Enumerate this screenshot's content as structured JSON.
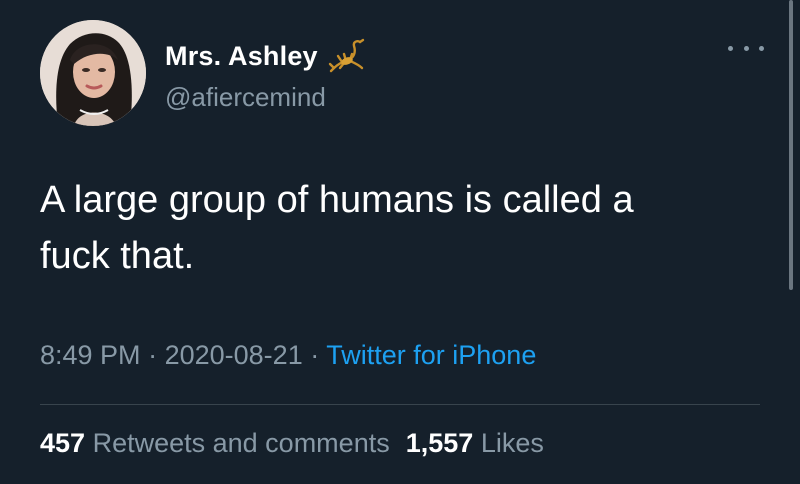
{
  "author": {
    "display_name": "Mrs. Ashley",
    "handle": "@afiercemind",
    "name_emoji": "scorpion-icon",
    "avatar": "avatar"
  },
  "tweet": {
    "text_line1": "A large group of humans is called a",
    "text_line2": "fuck that."
  },
  "meta": {
    "time": "8:49 PM",
    "separator": "·",
    "date": "2020-08-21",
    "source": "Twitter for iPhone"
  },
  "stats": {
    "retweets_count": "457",
    "retweets_label": "Retweets and comments",
    "likes_count": "1,557",
    "likes_label": "Likes"
  },
  "colors": {
    "background": "#15202b",
    "text_primary": "#ffffff",
    "text_secondary": "#8899a6",
    "link": "#1da1f2",
    "divider": "#38444d"
  },
  "icons": {
    "more": "more-options-icon"
  }
}
